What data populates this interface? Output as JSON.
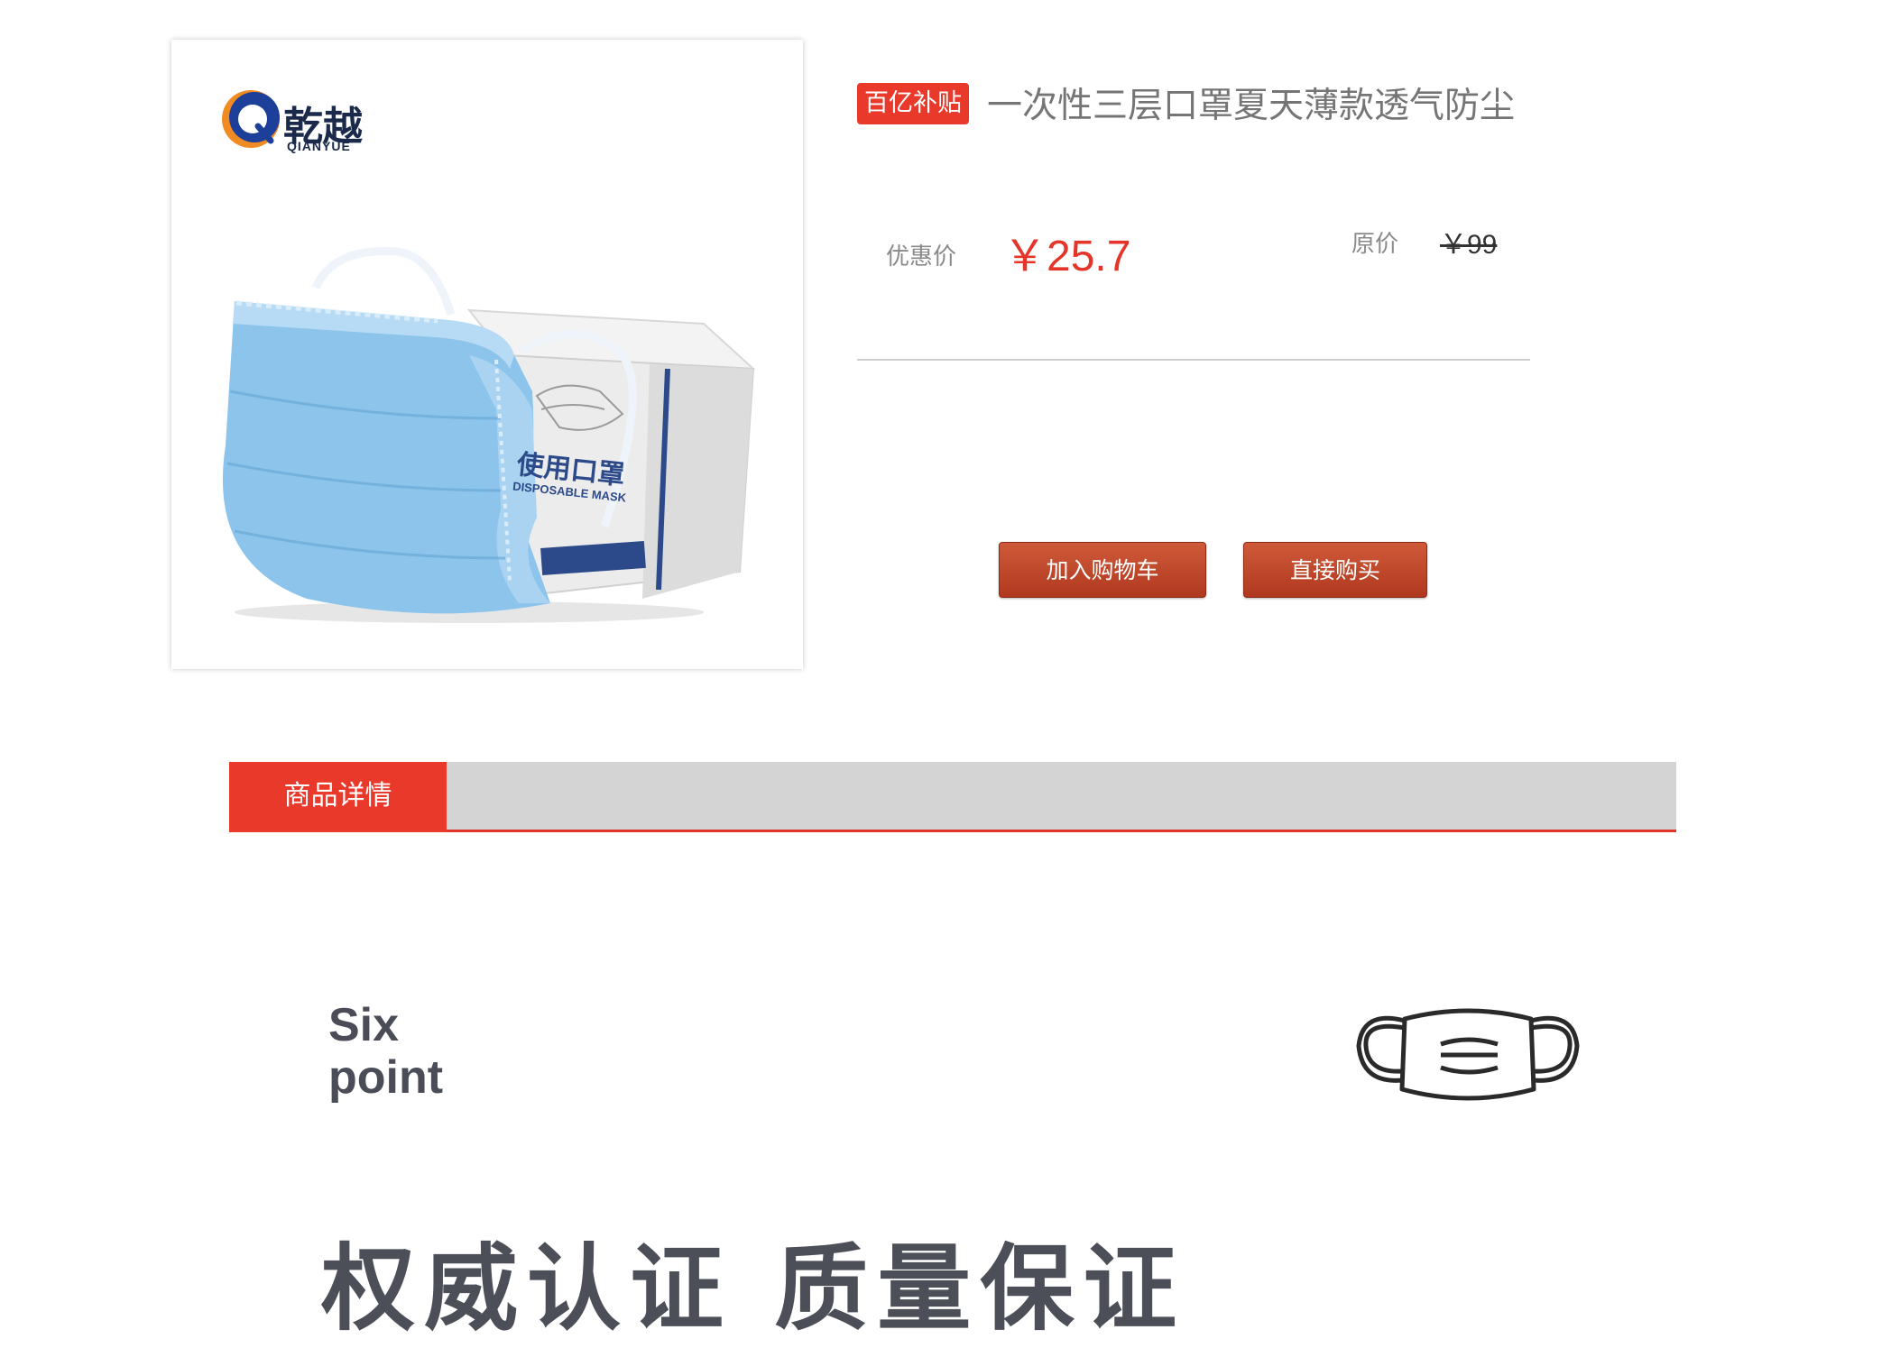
{
  "product": {
    "brand_cn": "乾越",
    "brand_en": "QIANYUE",
    "box_text_cn": "使用口罩",
    "box_text_en": "DISPOSABLE MASK",
    "badge": "百亿补贴",
    "title": "一次性三层口罩夏天薄款透气防尘",
    "price_label": "优惠价",
    "price": "￥25.7",
    "original_label": "原价",
    "original_price": "￥99"
  },
  "actions": {
    "add_to_cart": "加入购物车",
    "buy_now": "直接购买"
  },
  "details": {
    "tab_label": "商品详情",
    "six_line1": "Six",
    "six_line2": "point",
    "heading": "权威认证 质量保证"
  },
  "colors": {
    "accent_red": "#e8392b",
    "button_brown": "#b0381f",
    "mask_blue": "#8cc4ec"
  }
}
